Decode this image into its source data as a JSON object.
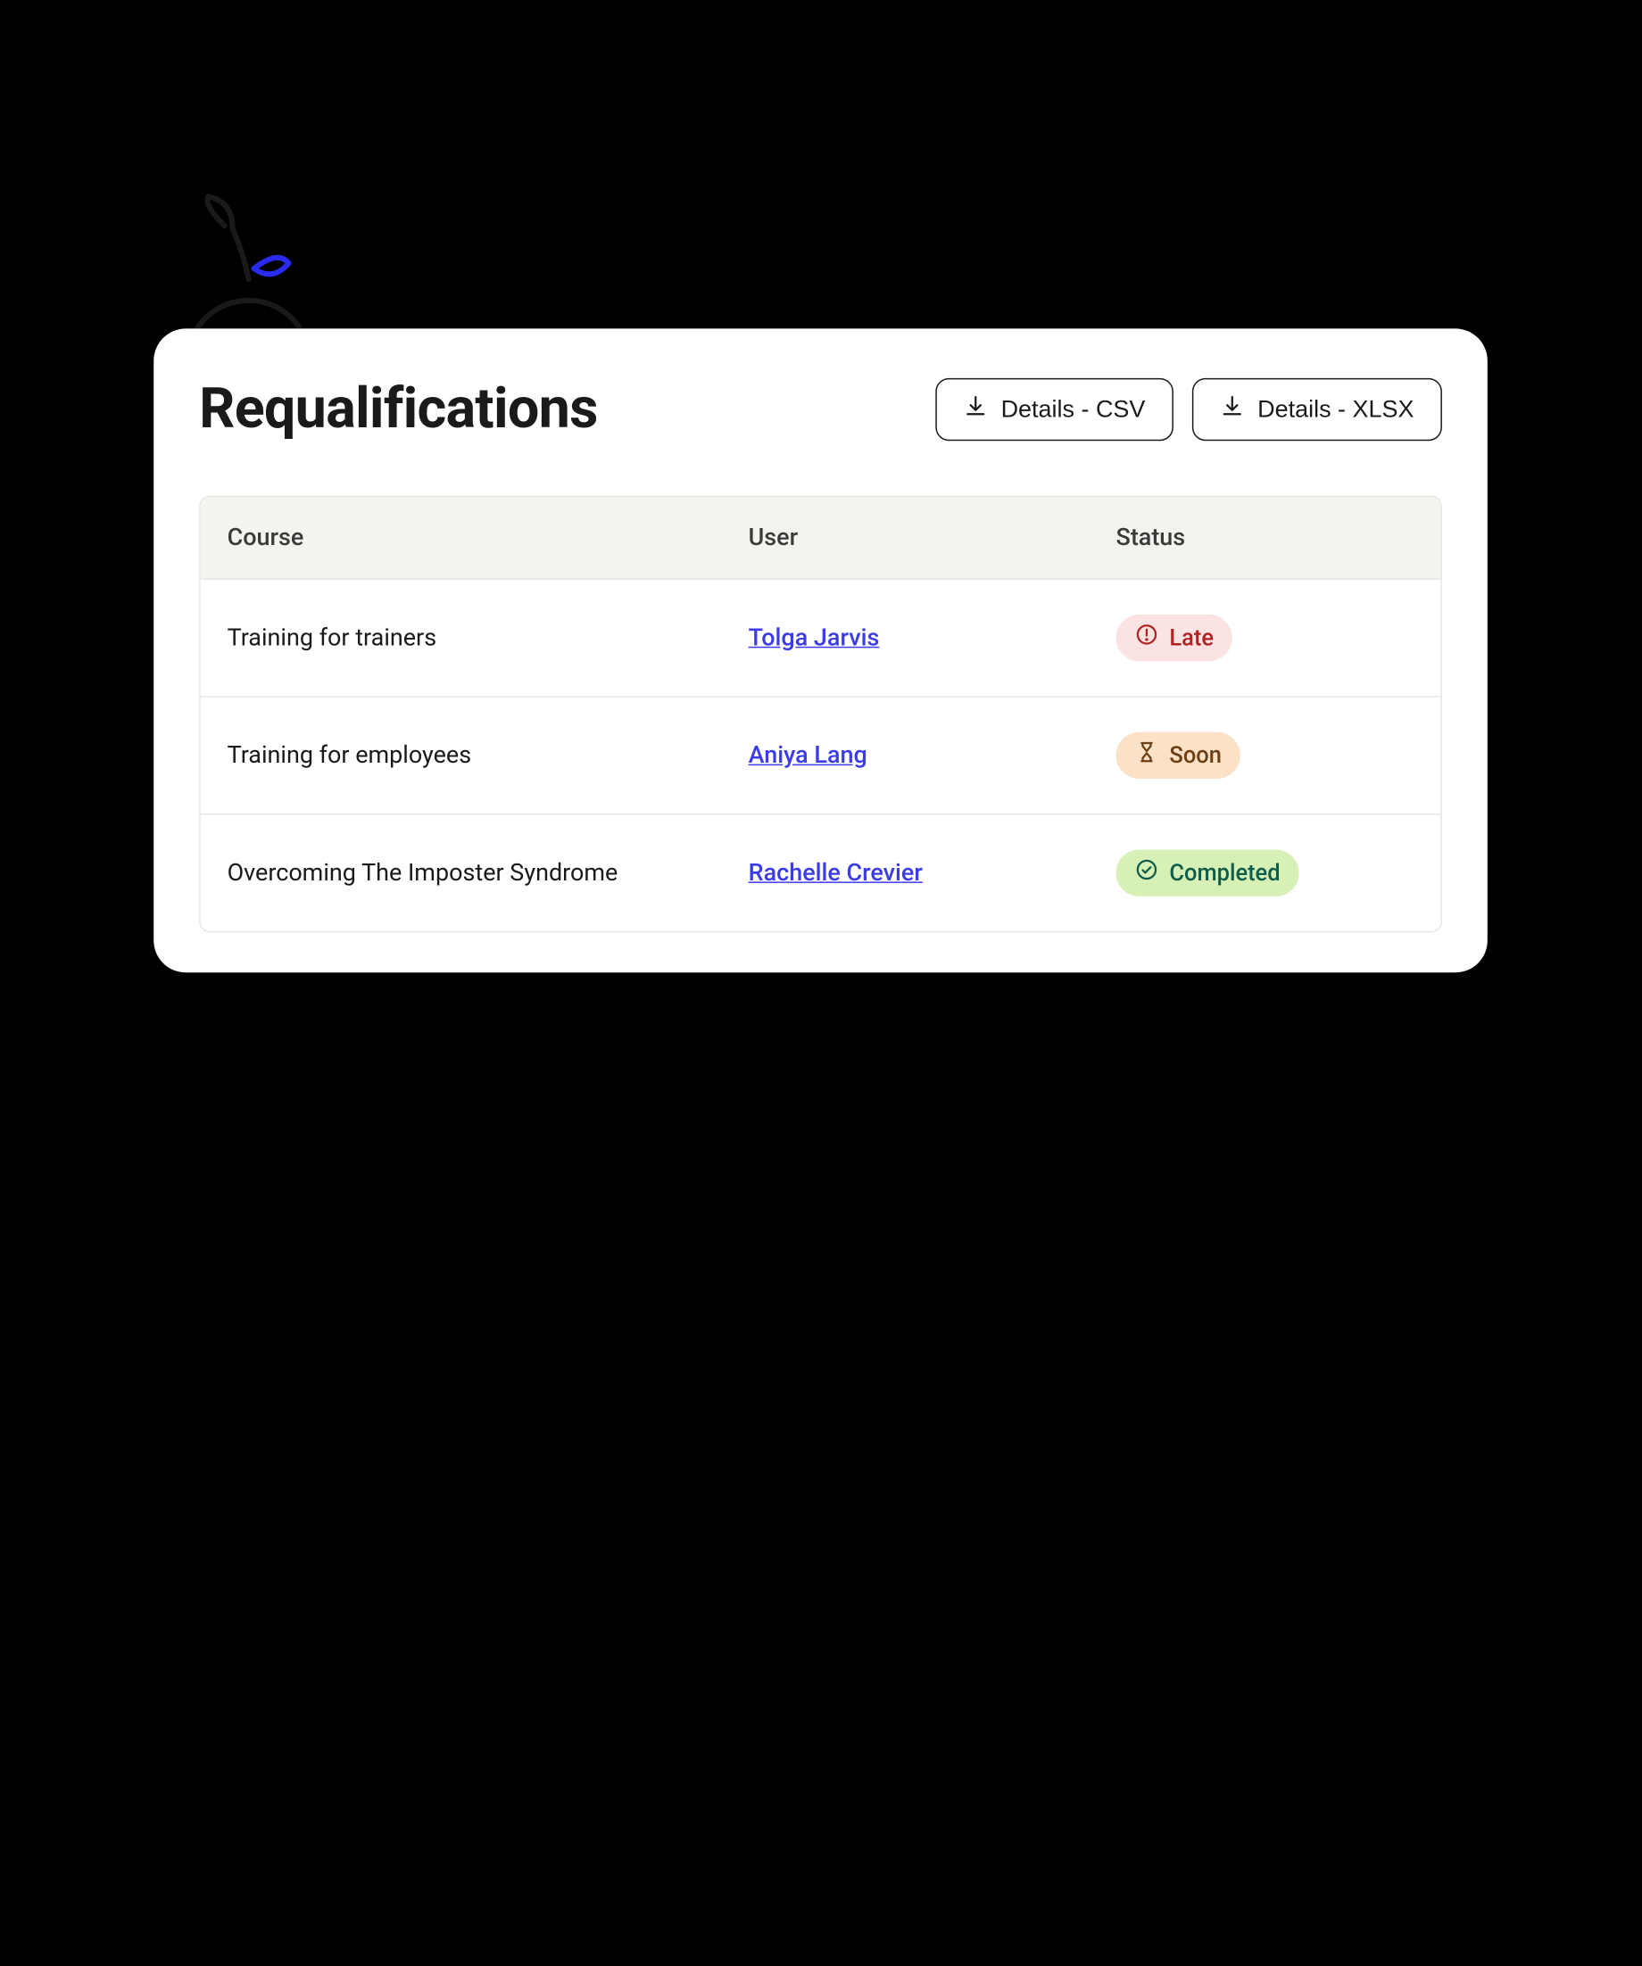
{
  "header": {
    "title": "Requalifications",
    "buttons": {
      "csv": "Details - CSV",
      "xlsx": "Details - XLSX"
    }
  },
  "table": {
    "columns": {
      "course": "Course",
      "user": "User",
      "status": "Status"
    },
    "rows": [
      {
        "course": "Training for trainers",
        "user": "Tolga Jarvis",
        "status": {
          "label": "Late",
          "kind": "late"
        }
      },
      {
        "course": "Training for employees",
        "user": "Aniya Lang",
        "status": {
          "label": "Soon",
          "kind": "soon"
        }
      },
      {
        "course": "Overcoming The Imposter Syndrome",
        "user": "Rachelle Crevier",
        "status": {
          "label": "Completed",
          "kind": "completed"
        }
      }
    ]
  }
}
